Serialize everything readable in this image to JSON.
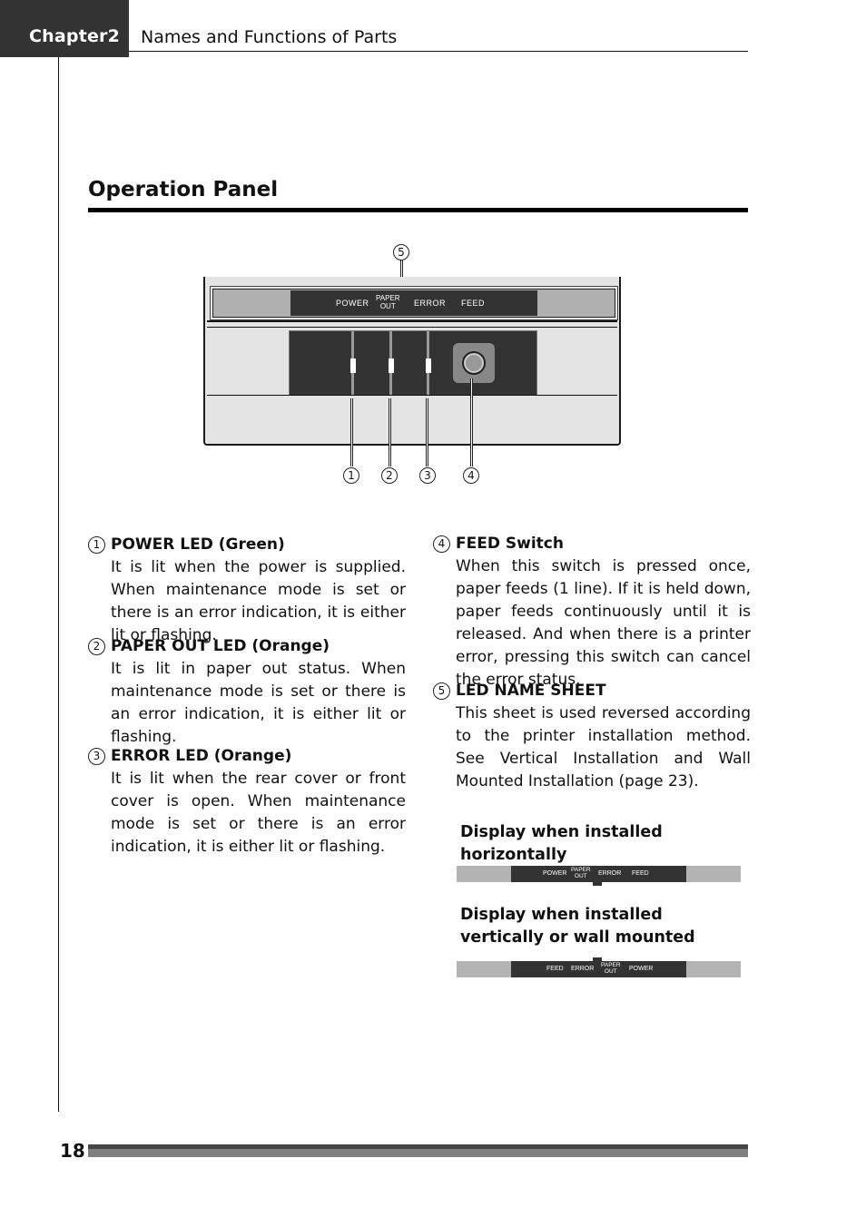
{
  "header": {
    "chapter": "Chapter2",
    "section": "Names and Functions of Parts"
  },
  "page_heading": "Operation Panel",
  "diagram": {
    "sheet_labels": {
      "power": "POWER",
      "paper_out_line1": "PAPER",
      "paper_out_line2": "OUT",
      "error": "ERROR",
      "feed": "FEED"
    },
    "callouts": [
      "①",
      "②",
      "③",
      "④",
      "⑤"
    ]
  },
  "items": [
    {
      "num": "1",
      "title": "POWER LED (Green)",
      "body": "It is lit when the power is supplied. When maintenance mode is set or there is an error indication, it is either lit or flashing."
    },
    {
      "num": "2",
      "title": "PAPER OUT LED (Orange)",
      "body": "It is lit in paper out status. When maintenance mode is set or there is an error indication, it is either lit or flashing."
    },
    {
      "num": "3",
      "title": "ERROR LED (Orange)",
      "body": "It is lit when the rear cover or front cover is open. When maintenance mode is set or there is an error indication, it is either lit or flashing."
    },
    {
      "num": "4",
      "title": "FEED Switch",
      "body": "When this switch is pressed once, paper feeds (1 line). If it is held down, paper feeds continuously until it is released. And when there is a printer error, pressing this switch can cancel the error status."
    },
    {
      "num": "5",
      "title": "LED NAME SHEET",
      "body": "This sheet is used reversed according to the printer installation method. See Vertical Installation and Wall Mounted Installation (page 23)."
    }
  ],
  "display_horizontal": {
    "heading": "Display when installed horizontally",
    "labels": [
      "POWER",
      "PAPER",
      "OUT",
      "ERROR",
      "FEED"
    ]
  },
  "display_vertical": {
    "heading": "Display when installed vertically or wall mounted",
    "labels": [
      "FEED",
      "ERROR",
      "PAPER",
      "OUT",
      "POWER"
    ]
  },
  "footer": {
    "page_number": "18"
  }
}
